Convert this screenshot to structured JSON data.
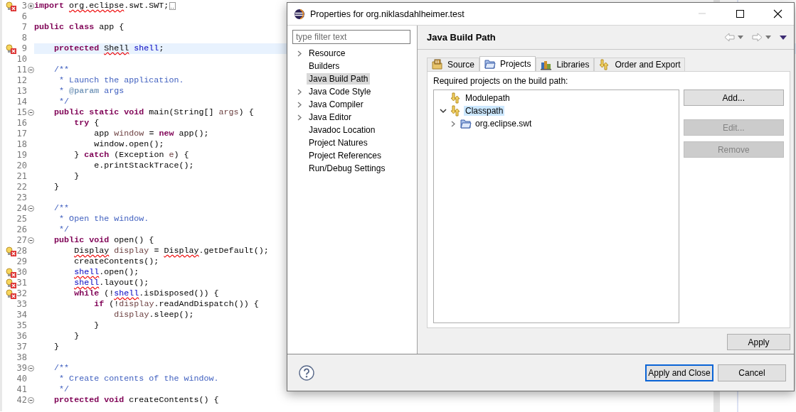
{
  "editor": {
    "lines": [
      {
        "number": "3",
        "error": true,
        "expanded": false,
        "current": false,
        "folded_block": true,
        "tokens": [
          {
            "kind": "kw",
            "text": "import"
          },
          {
            "kind": "plain",
            "text": " org.eclipse",
            "error": true
          },
          {
            "kind": "plain",
            "text": ".swt.SWT;"
          }
        ]
      },
      {
        "number": "6",
        "error": false,
        "current": false
      },
      {
        "number": "7",
        "error": false,
        "current": false,
        "tokens": [
          {
            "kind": "kw",
            "text": "public class"
          },
          {
            "kind": "plain",
            "text": " app {"
          }
        ]
      },
      {
        "number": "8",
        "error": false,
        "current": false
      },
      {
        "number": "9",
        "error": true,
        "current": true,
        "tokens": [
          {
            "kind": "kw",
            "text": "    protected"
          },
          {
            "kind": "plain",
            "text": " Shell",
            "error": true
          },
          {
            "kind": "field",
            "text": " shell"
          },
          {
            "kind": "plain",
            "text": ";"
          }
        ]
      },
      {
        "number": "10",
        "error": false,
        "current": false
      },
      {
        "number": "11",
        "error": false,
        "expanded": true,
        "current": false,
        "tokens": [
          {
            "kind": "comment",
            "text": "    /**"
          }
        ]
      },
      {
        "number": "12",
        "error": false,
        "current": false,
        "tokens": [
          {
            "kind": "comment",
            "text": "     * Launch the application."
          }
        ]
      },
      {
        "number": "13",
        "error": false,
        "current": false,
        "tokens": [
          {
            "kind": "comment",
            "text": "     *"
          },
          {
            "kind": "tag",
            "text": " @param"
          },
          {
            "kind": "comment",
            "text": " args"
          }
        ]
      },
      {
        "number": "14",
        "error": false,
        "current": false,
        "tokens": [
          {
            "kind": "comment",
            "text": "     */"
          }
        ]
      },
      {
        "number": "15",
        "error": false,
        "expanded": true,
        "current": false,
        "tokens": [
          {
            "kind": "kw",
            "text": "    public static void"
          },
          {
            "kind": "plain",
            "text": " main(String[]"
          },
          {
            "kind": "local",
            "text": " args"
          },
          {
            "kind": "plain",
            "text": ") {"
          }
        ]
      },
      {
        "number": "16",
        "error": false,
        "current": false,
        "tokens": [
          {
            "kind": "kw",
            "text": "        try"
          },
          {
            "kind": "plain",
            "text": " {"
          }
        ]
      },
      {
        "number": "17",
        "error": false,
        "current": false,
        "tokens": [
          {
            "kind": "plain",
            "text": "            app"
          },
          {
            "kind": "local",
            "text": " window"
          },
          {
            "kind": "plain",
            "text": " ="
          },
          {
            "kind": "kw",
            "text": " new"
          },
          {
            "kind": "plain",
            "text": " app();"
          }
        ]
      },
      {
        "number": "18",
        "error": false,
        "current": false,
        "tokens": [
          {
            "kind": "plain",
            "text": "            window.open();"
          }
        ]
      },
      {
        "number": "19",
        "error": false,
        "current": false,
        "tokens": [
          {
            "kind": "plain",
            "text": "        }"
          },
          {
            "kind": "kw",
            "text": " catch"
          },
          {
            "kind": "plain",
            "text": " (Exception"
          },
          {
            "kind": "local",
            "text": " e"
          },
          {
            "kind": "plain",
            "text": ") {"
          }
        ]
      },
      {
        "number": "20",
        "error": false,
        "current": false,
        "tokens": [
          {
            "kind": "plain",
            "text": "            e.printStackTrace();"
          }
        ]
      },
      {
        "number": "21",
        "error": false,
        "current": false,
        "tokens": [
          {
            "kind": "plain",
            "text": "        }"
          }
        ]
      },
      {
        "number": "22",
        "error": false,
        "current": false,
        "tokens": [
          {
            "kind": "plain",
            "text": "    }"
          }
        ]
      },
      {
        "number": "23",
        "error": false,
        "current": false
      },
      {
        "number": "24",
        "error": false,
        "expanded": true,
        "current": false,
        "tokens": [
          {
            "kind": "comment",
            "text": "    /**"
          }
        ]
      },
      {
        "number": "25",
        "error": false,
        "current": false,
        "tokens": [
          {
            "kind": "comment",
            "text": "     * Open the window."
          }
        ]
      },
      {
        "number": "26",
        "error": false,
        "current": false,
        "tokens": [
          {
            "kind": "comment",
            "text": "     */"
          }
        ]
      },
      {
        "number": "27",
        "error": false,
        "expanded": true,
        "current": false,
        "tokens": [
          {
            "kind": "kw",
            "text": "    public void"
          },
          {
            "kind": "plain",
            "text": " open() {"
          }
        ]
      },
      {
        "number": "28",
        "error": true,
        "current": false,
        "tokens": [
          {
            "kind": "plain",
            "text": "        Display",
            "error": true
          },
          {
            "kind": "local",
            "text": " display"
          },
          {
            "kind": "plain",
            "text": " ="
          },
          {
            "kind": "plain",
            "text": " Display",
            "error": true
          },
          {
            "kind": "plain",
            "text": ".getDefault();"
          }
        ]
      },
      {
        "number": "29",
        "error": false,
        "current": false,
        "tokens": [
          {
            "kind": "plain",
            "text": "        createContents();"
          }
        ]
      },
      {
        "number": "30",
        "error": true,
        "current": false,
        "tokens": [
          {
            "kind": "field",
            "text": "        shell",
            "error": true
          },
          {
            "kind": "plain",
            "text": ".open();"
          }
        ]
      },
      {
        "number": "31",
        "error": true,
        "current": false,
        "tokens": [
          {
            "kind": "field",
            "text": "        shell",
            "error": true
          },
          {
            "kind": "plain",
            "text": ".layout();"
          }
        ]
      },
      {
        "number": "32",
        "error": true,
        "current": false,
        "tokens": [
          {
            "kind": "kw",
            "text": "        while"
          },
          {
            "kind": "plain",
            "text": " (!"
          },
          {
            "kind": "field",
            "text": "shell",
            "error": true
          },
          {
            "kind": "plain",
            "text": ".isDisposed()) {"
          }
        ]
      },
      {
        "number": "33",
        "error": false,
        "current": false,
        "tokens": [
          {
            "kind": "kw",
            "text": "            if"
          },
          {
            "kind": "plain",
            "text": " (!"
          },
          {
            "kind": "local",
            "text": "display"
          },
          {
            "kind": "plain",
            "text": ".readAndDispatch()) {"
          }
        ]
      },
      {
        "number": "34",
        "error": false,
        "current": false,
        "tokens": [
          {
            "kind": "local",
            "text": "                display"
          },
          {
            "kind": "plain",
            "text": ".sleep();"
          }
        ]
      },
      {
        "number": "35",
        "error": false,
        "current": false,
        "tokens": [
          {
            "kind": "plain",
            "text": "            }"
          }
        ]
      },
      {
        "number": "36",
        "error": false,
        "current": false,
        "tokens": [
          {
            "kind": "plain",
            "text": "        }"
          }
        ]
      },
      {
        "number": "37",
        "error": false,
        "current": false,
        "tokens": [
          {
            "kind": "plain",
            "text": "    }"
          }
        ]
      },
      {
        "number": "38",
        "error": false,
        "current": false
      },
      {
        "number": "39",
        "error": false,
        "expanded": true,
        "current": false,
        "tokens": [
          {
            "kind": "comment",
            "text": "    /**"
          }
        ]
      },
      {
        "number": "40",
        "error": false,
        "current": false,
        "tokens": [
          {
            "kind": "comment",
            "text": "     * Create contents of the window."
          }
        ]
      },
      {
        "number": "41",
        "error": false,
        "current": false,
        "tokens": [
          {
            "kind": "comment",
            "text": "     */"
          }
        ]
      },
      {
        "number": "42",
        "error": false,
        "expanded": true,
        "current": false,
        "tokens": [
          {
            "kind": "kw",
            "text": "    protected void"
          },
          {
            "kind": "plain",
            "text": " createContents() {"
          }
        ]
      }
    ]
  },
  "dialog": {
    "title": "Properties for org.niklasdahlheimer.test",
    "filter": {
      "placeholder": "type filter text"
    },
    "pages": [
      {
        "label": "Resource",
        "expanded": false,
        "selected": false
      },
      {
        "label": "Builders",
        "selected": false
      },
      {
        "label": "Java Build Path",
        "selected": true
      },
      {
        "label": "Java Code Style",
        "expanded": false,
        "selected": false
      },
      {
        "label": "Java Compiler",
        "expanded": false,
        "selected": false
      },
      {
        "label": "Java Editor",
        "expanded": false,
        "selected": false
      },
      {
        "label": "Javadoc Location",
        "selected": false
      },
      {
        "label": "Project Natures",
        "selected": false
      },
      {
        "label": "Project References",
        "selected": false
      },
      {
        "label": "Run/Debug Settings",
        "selected": false
      }
    ],
    "page_title": "Java Build Path",
    "tabs": [
      {
        "label": "Source",
        "kind": "source",
        "selected": false
      },
      {
        "label": "Projects",
        "kind": "projects",
        "selected": true
      },
      {
        "label": "Libraries",
        "kind": "libraries",
        "selected": false
      },
      {
        "label": "Order and Export",
        "kind": "order",
        "selected": false
      }
    ],
    "list_label": "Required projects on the build path:",
    "entries": [
      {
        "label": "Modulepath",
        "kind": "path",
        "selected": false
      },
      {
        "label": "Classpath",
        "kind": "path",
        "expanded": true,
        "selected": true,
        "children": [
          {
            "label": "org.eclipse.swt",
            "kind": "project",
            "expanded": false,
            "selected": false
          }
        ]
      }
    ],
    "side_buttons": [
      {
        "label": "Add...",
        "disabled": false
      },
      {
        "label": "Edit...",
        "disabled": true
      },
      {
        "label": "Remove",
        "disabled": true
      }
    ],
    "apply": "Apply",
    "footer_buttons": [
      {
        "label": "Apply and Close",
        "default": true
      },
      {
        "label": "Cancel",
        "default": false
      }
    ]
  }
}
